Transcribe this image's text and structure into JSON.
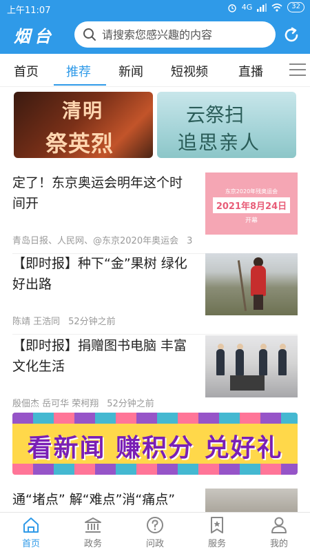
{
  "status_bar": {
    "time": "上午11:07",
    "network": "4G",
    "battery": "32"
  },
  "header": {
    "logo_text": "烟台",
    "search_placeholder": "请搜索您感兴趣的内容",
    "brand_color": "#2f9ae8"
  },
  "tabs": [
    {
      "label": "首页",
      "active": false
    },
    {
      "label": "推荐",
      "active": true
    },
    {
      "label": "新闻",
      "active": false
    },
    {
      "label": "短视频",
      "active": false
    },
    {
      "label": "直播",
      "active": false
    }
  ],
  "banners": [
    {
      "line1": "清明",
      "line2": "祭英烈"
    },
    {
      "line1": "云祭扫",
      "line2": "追思亲人"
    }
  ],
  "news": [
    {
      "title": "定了！东京奥运会明年这个时间开",
      "meta": [
        "青岛日报、人民网、@东京2020年奥运会",
        "3"
      ],
      "thumb": {
        "small": "东京2020年残奥运会",
        "date": "2021年8月24日",
        "open": "开幕"
      }
    },
    {
      "title": "【即时报】种下“金”果树 绿化好出路",
      "meta": [
        "陈靖 王浩同",
        "52分钟之前"
      ]
    },
    {
      "title": "【即时报】捐赠图书电脑 丰富文化生活",
      "meta": [
        "殷佃杰 岳可华 荣柯翔",
        "52分钟之前"
      ]
    }
  ],
  "ad": {
    "text": "看新闻 赚积分 兑好礼"
  },
  "next_item": {
    "title": "通“堵点” 解“难点”消“痛点”"
  },
  "bottom_nav": [
    {
      "label": "首页",
      "icon": "home-icon",
      "active": true
    },
    {
      "label": "政务",
      "icon": "government-icon",
      "active": false
    },
    {
      "label": "问政",
      "icon": "question-icon",
      "active": false
    },
    {
      "label": "服务",
      "icon": "service-icon",
      "active": false
    },
    {
      "label": "我的",
      "icon": "user-icon",
      "active": false
    }
  ]
}
